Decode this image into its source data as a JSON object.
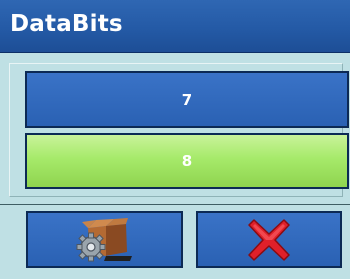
{
  "window": {
    "title": "DataBits"
  },
  "options": [
    {
      "label": "7",
      "selected": false
    },
    {
      "label": "8",
      "selected": true
    }
  ],
  "softkeys": {
    "ok_icon": "box-gear-icon",
    "cancel_icon": "red-x-icon"
  },
  "colors": {
    "title_bar": "#245aa6",
    "button_blue": "#3169bb",
    "selected_green": "#a6ea6a",
    "background": "#bfe0e4",
    "cancel_red": "#e0202a"
  }
}
